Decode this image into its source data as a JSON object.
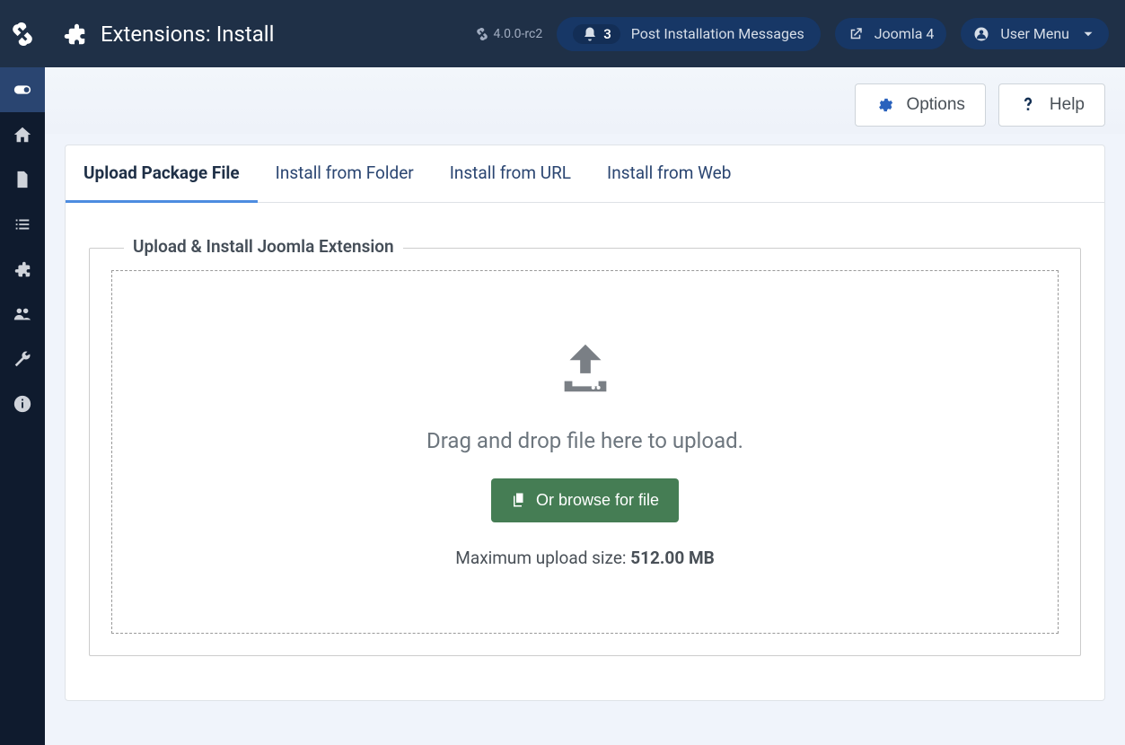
{
  "header": {
    "title": "Extensions: Install",
    "version": "4.0.0-rc2",
    "notifications": {
      "count": "3",
      "label": "Post Installation Messages"
    },
    "site_link": "Joomla 4",
    "user_menu": "User Menu"
  },
  "toolbar": {
    "options": "Options",
    "help": "Help"
  },
  "tabs": [
    {
      "label": "Upload Package File",
      "active": true
    },
    {
      "label": "Install from Folder",
      "active": false
    },
    {
      "label": "Install from URL",
      "active": false
    },
    {
      "label": "Install from Web",
      "active": false
    }
  ],
  "panel": {
    "legend": "Upload & Install Joomla Extension",
    "drop_message": "Drag and drop file here to upload.",
    "browse_label": "Or browse for file",
    "max_label": "Maximum upload size: ",
    "max_value": "512.00 MB"
  },
  "sidebar": {
    "items": [
      "brand",
      "toggle",
      "home",
      "content",
      "menus",
      "components",
      "users",
      "system",
      "info"
    ]
  }
}
